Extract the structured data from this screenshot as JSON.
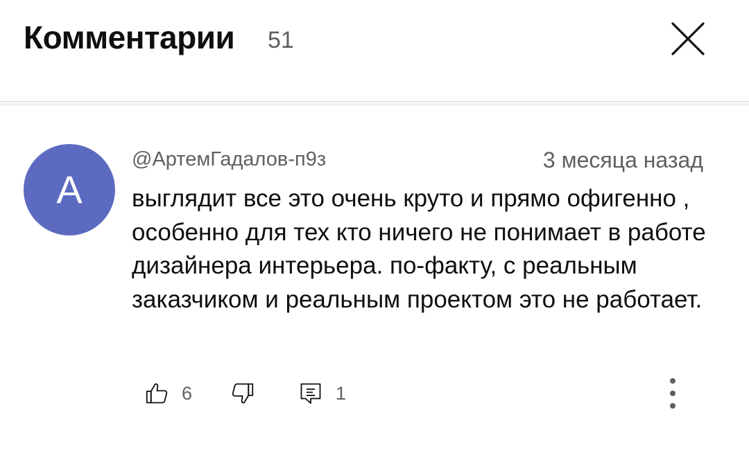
{
  "header": {
    "title": "Комментарии",
    "count": "51",
    "close_icon": "close-icon"
  },
  "comment": {
    "avatar_letter": "А",
    "avatar_color": "#5c6bc0",
    "author": "@АртемГадалов-п9з",
    "timestamp": "3 месяца назад",
    "text": "выглядит все это очень круто и прямо офигенно , особенно для тех кто ничего не понимает в работе дизайнера интерьера. по-факту, с реальным заказчиком и реальным проектом это не работает.",
    "likes": "6",
    "replies": "1",
    "icons": [
      "thumb-up-icon",
      "thumb-down-icon",
      "reply-icon",
      "more-vert-icon"
    ]
  }
}
